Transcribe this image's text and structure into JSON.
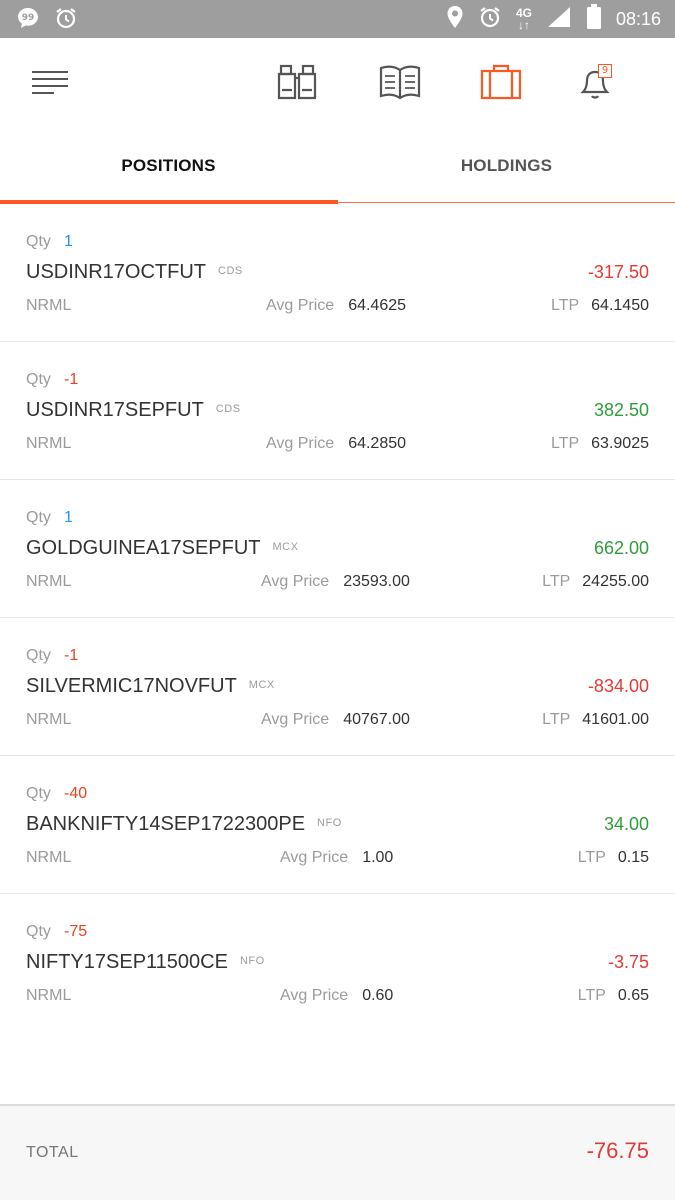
{
  "status_bar": {
    "time": "08:16",
    "network": "4G",
    "icons": [
      "chat-bubble-icon",
      "alarm-icon",
      "location-icon",
      "alarm-icon",
      "signal-icon",
      "battery-icon"
    ]
  },
  "app_bar": {
    "icons": [
      "menu-icon",
      "binoculars-icon",
      "book-icon",
      "briefcase-icon",
      "bell-icon"
    ],
    "notification_count": "9",
    "accent": "#ff5722"
  },
  "tabs": [
    {
      "label": "POSITIONS",
      "active": true
    },
    {
      "label": "HOLDINGS",
      "active": false
    }
  ],
  "positions": [
    {
      "qty_label": "Qty",
      "qty": "1",
      "symbol": "USDINR17OCTFUT",
      "exchange": "CDS",
      "pnl": "-317.50",
      "product": "NRML",
      "avg_label": "Avg Price",
      "avg": "64.4625",
      "ltp_label": "LTP",
      "ltp": "64.1450"
    },
    {
      "qty_label": "Qty",
      "qty": "-1",
      "symbol": "USDINR17SEPFUT",
      "exchange": "CDS",
      "pnl": "382.50",
      "product": "NRML",
      "avg_label": "Avg Price",
      "avg": "64.2850",
      "ltp_label": "LTP",
      "ltp": "63.9025"
    },
    {
      "qty_label": "Qty",
      "qty": "1",
      "symbol": "GOLDGUINEA17SEPFUT",
      "exchange": "MCX",
      "pnl": "662.00",
      "product": "NRML",
      "avg_label": "Avg Price",
      "avg": "23593.00",
      "ltp_label": "LTP",
      "ltp": "24255.00"
    },
    {
      "qty_label": "Qty",
      "qty": "-1",
      "symbol": "SILVERMIC17NOVFUT",
      "exchange": "MCX",
      "pnl": "-834.00",
      "product": "NRML",
      "avg_label": "Avg Price",
      "avg": "40767.00",
      "ltp_label": "LTP",
      "ltp": "41601.00"
    },
    {
      "qty_label": "Qty",
      "qty": "-40",
      "symbol": "BANKNIFTY14SEP1722300PE",
      "exchange": "NFO",
      "pnl": "34.00",
      "product": "NRML",
      "avg_label": "Avg Price",
      "avg": "1.00",
      "ltp_label": "LTP",
      "ltp": "0.15"
    },
    {
      "qty_label": "Qty",
      "qty": "-75",
      "symbol": "NIFTY17SEP11500CE",
      "exchange": "NFO",
      "pnl": "-3.75",
      "product": "NRML",
      "avg_label": "Avg Price",
      "avg": "0.60",
      "ltp_label": "LTP",
      "ltp": "0.65"
    }
  ],
  "total": {
    "label": "TOTAL",
    "value": "-76.75"
  },
  "colors": {
    "positive": "#2e9e3a",
    "negative": "#e53935",
    "qty_positive": "#2196f3",
    "qty_negative": "#e8431f"
  }
}
